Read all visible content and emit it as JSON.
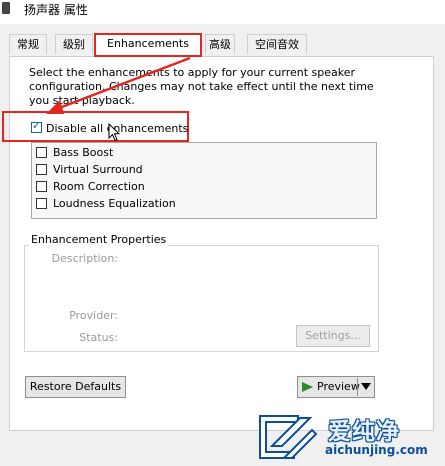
{
  "window": {
    "title": "扬声器 属性"
  },
  "tabs": [
    {
      "label": "常规"
    },
    {
      "label": "级别"
    },
    {
      "label": "Enhancements"
    },
    {
      "label": "高级"
    },
    {
      "label": "空间音效"
    }
  ],
  "active_tab": "Enhancements",
  "instructions": "Select the enhancements to apply for your current speaker configuration. Changes may not take effect until the next time you start playback.",
  "disable_all": {
    "label": "Disable all enhancements",
    "checked": true
  },
  "enhancements": [
    {
      "label": "Bass Boost",
      "checked": false
    },
    {
      "label": "Virtual Surround",
      "checked": false
    },
    {
      "label": "Room Correction",
      "checked": false
    },
    {
      "label": "Loudness Equalization",
      "checked": false
    }
  ],
  "properties": {
    "title": "Enhancement Properties",
    "description_label": "Description:",
    "provider_label": "Provider:",
    "status_label": "Status:",
    "settings_button": "Settings..."
  },
  "buttons": {
    "restore_defaults": "Restore Defaults",
    "preview": "Preview"
  },
  "watermark": {
    "cn": "爱纯净",
    "url": "aichunjing.com"
  },
  "colors": {
    "highlight": "#e0281e",
    "accent": "#1a5fb4",
    "watermark": "#0b4f9c"
  }
}
